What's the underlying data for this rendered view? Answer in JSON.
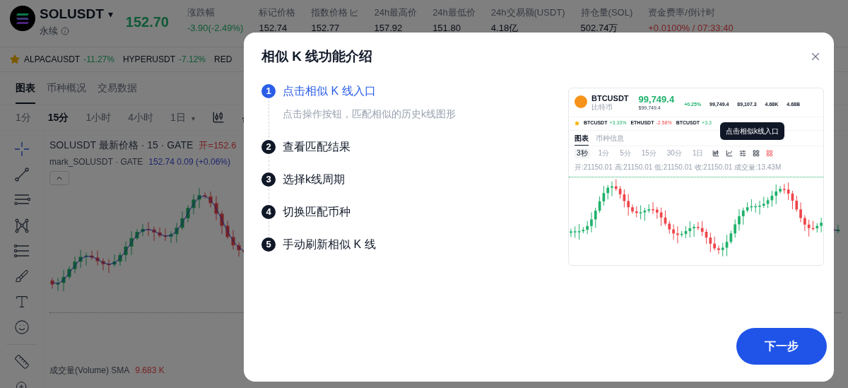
{
  "header": {
    "symbol": "SOLUSDT",
    "symbol_caret": "▾",
    "price": "152.70",
    "contract_type": "永续",
    "stats": [
      {
        "label": "涨跌幅",
        "value": "-3.90(-2.49%)",
        "kind": "falling"
      },
      {
        "label": "标记价格",
        "value": "152.74",
        "kind": "neutral"
      },
      {
        "label": "指数价格",
        "value": "152.77",
        "kind": "neutral"
      },
      {
        "label": "24h最高价",
        "value": "157.92",
        "kind": "neutral"
      },
      {
        "label": "24h最低价",
        "value": "151.80",
        "kind": "neutral"
      },
      {
        "label": "24h交易额(USDT)",
        "value": "4.18亿",
        "kind": "neutral"
      },
      {
        "label": "持仓量(SOL)",
        "value": "502.74万",
        "kind": "neutral"
      },
      {
        "label": "资金费率/倒计时",
        "value": "+0.0100% / 07:33:40",
        "kind": "rising"
      }
    ]
  },
  "ticker": [
    {
      "symbol": "ALPACAUSDT",
      "change": "-11.27%",
      "kind": "falling"
    },
    {
      "symbol": "HYPERUSDT",
      "change": "-7.12%",
      "kind": "falling"
    },
    {
      "symbol": "RED"
    }
  ],
  "tabs": [
    {
      "label": "图表",
      "selected": true
    },
    {
      "label": "币种概况",
      "selected": false
    },
    {
      "label": "交易数据",
      "selected": false
    }
  ],
  "intervals": [
    {
      "label": "1分",
      "selected": false
    },
    {
      "label": "15分",
      "selected": true
    },
    {
      "label": "1小时",
      "selected": false
    },
    {
      "label": "4小时",
      "selected": false
    },
    {
      "label": "1日",
      "selected": false,
      "caret": "▾"
    }
  ],
  "chart": {
    "title": "SOLUSDT 最新价格 · 15 · GATE",
    "open": "开=152.6",
    "mark_label": "mark_SOLUSDT · GATE",
    "mark_value": "152.74 0.09 (+0.06%)",
    "volume_label": "成交量(Volume) SMA",
    "volume_value": "9.683 K"
  },
  "modal": {
    "title": "相似 K 线功能介绍",
    "steps": [
      {
        "number": "1",
        "title": "点击相似 K 线入口",
        "description": "点击操作按钮，匹配相似的历史k线图形",
        "selected": true
      },
      {
        "number": "2",
        "title": "查看匹配结果",
        "selected": false
      },
      {
        "number": "3",
        "title": "选择k线周期",
        "selected": false
      },
      {
        "number": "4",
        "title": "切换匹配币种",
        "selected": false
      },
      {
        "number": "5",
        "title": "手动刷新相似 K 线",
        "selected": false
      }
    ],
    "preview": {
      "symbol": "BTCUSDT",
      "name": "比特币",
      "price": "99,749.4",
      "index_price": "$99,749.4",
      "stats": [
        {
          "value": "+0.25%",
          "kind": "rising"
        },
        {
          "value": "99,749.4",
          "kind": "neutral"
        },
        {
          "value": "89,107.3",
          "kind": "neutral"
        },
        {
          "value": "4.68K",
          "kind": "neutral"
        },
        {
          "value": "4.68B",
          "kind": "neutral"
        }
      ],
      "ticker": [
        {
          "symbol": "BTCUSDT",
          "change": "+3.33%",
          "kind": "rising"
        },
        {
          "symbol": "ETHUSDT",
          "change": "-2.58%",
          "kind": "falling"
        },
        {
          "symbol": "BTCUSDT",
          "change": "+3.3",
          "kind": "rising"
        }
      ],
      "tooltip": "点击相似k线入口",
      "tabs": [
        {
          "label": "图表",
          "selected": true
        },
        {
          "label": "币种信息",
          "selected": false
        }
      ],
      "intervals": [
        {
          "label": "3秒",
          "selected": true
        },
        {
          "label": "1分",
          "selected": false
        },
        {
          "label": "5分",
          "selected": false
        },
        {
          "label": "15分",
          "selected": false
        },
        {
          "label": "30分",
          "selected": false
        },
        {
          "label": "1日",
          "selected": false
        }
      ],
      "ohlc": "开:21150.01 高:21150.01 低:21150.01 收:21150.01 成交量:13.43M"
    },
    "next_button": "下一步"
  }
}
